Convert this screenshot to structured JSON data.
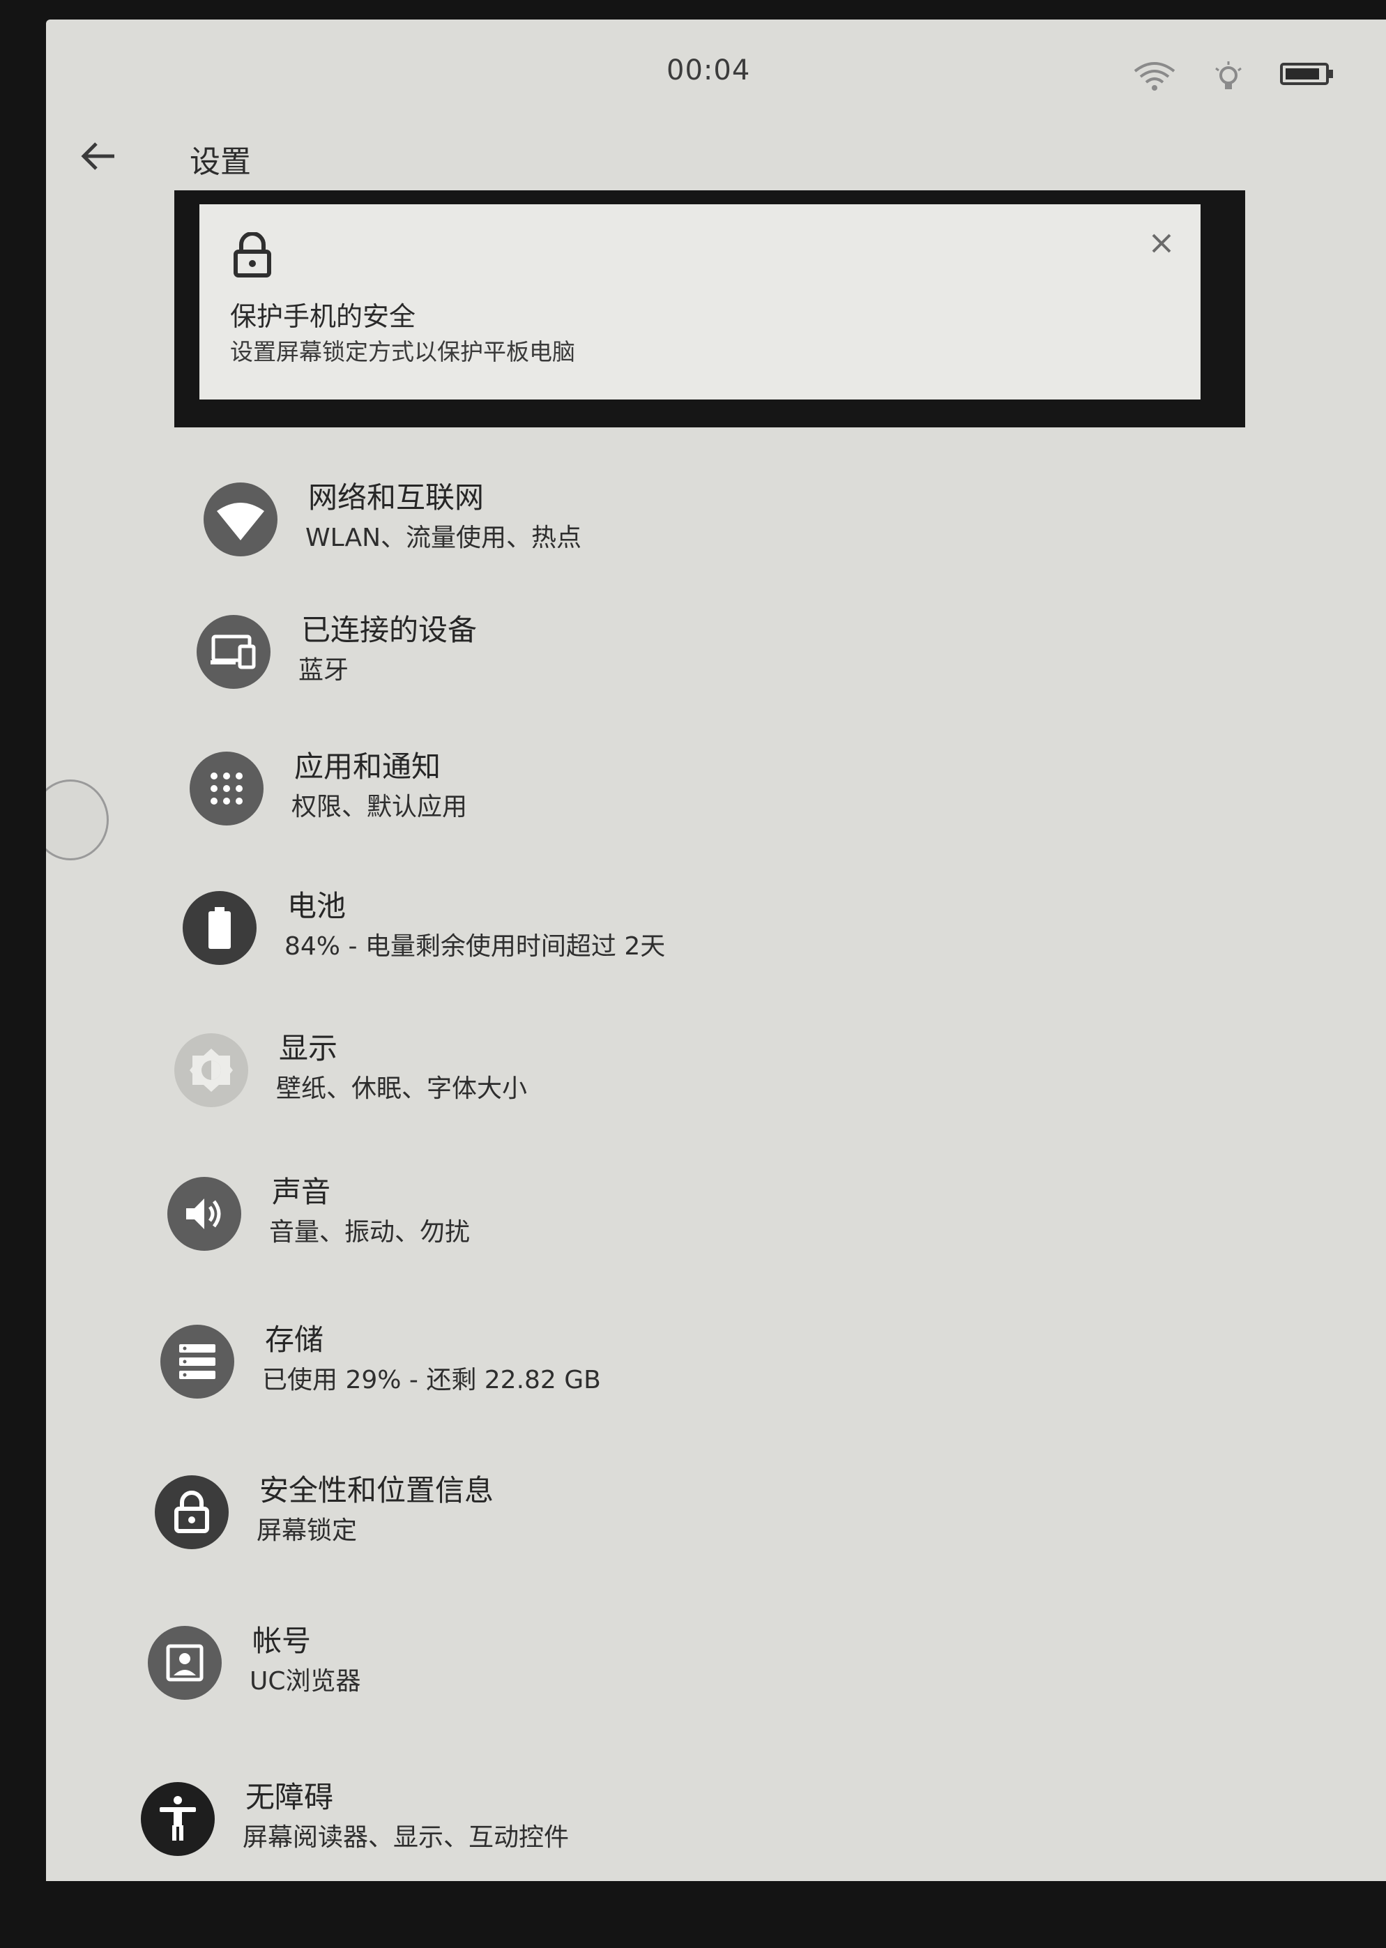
{
  "status": {
    "time": "00:04"
  },
  "header": {
    "title": "设置"
  },
  "banner": {
    "title": "保护手机的安全",
    "subtitle": "设置屏幕锁定方式以保护平板电脑"
  },
  "items": [
    {
      "title": "网络和互联网",
      "subtitle": "WLAN、流量使用、热点",
      "icon": "wifi-icon"
    },
    {
      "title": "已连接的设备",
      "subtitle": "蓝牙",
      "icon": "connected-devices-icon"
    },
    {
      "title": "应用和通知",
      "subtitle": "权限、默认应用",
      "icon": "apps-grid-icon"
    },
    {
      "title": "电池",
      "subtitle": "84% - 电量剩余使用时间超过 2天",
      "icon": "battery-icon"
    },
    {
      "title": "显示",
      "subtitle": "壁纸、休眠、字体大小",
      "icon": "brightness-icon"
    },
    {
      "title": "声音",
      "subtitle": "音量、振动、勿扰",
      "icon": "volume-icon"
    },
    {
      "title": "存储",
      "subtitle": "已使用 29% - 还剩 22.82 GB",
      "icon": "storage-icon"
    },
    {
      "title": "安全性和位置信息",
      "subtitle": "屏幕锁定",
      "icon": "lock-icon"
    },
    {
      "title": "帐号",
      "subtitle": "UC浏览器",
      "icon": "account-icon"
    },
    {
      "title": "无障碍",
      "subtitle": "屏幕阅读器、显示、互动控件",
      "icon": "accessibility-icon"
    }
  ]
}
